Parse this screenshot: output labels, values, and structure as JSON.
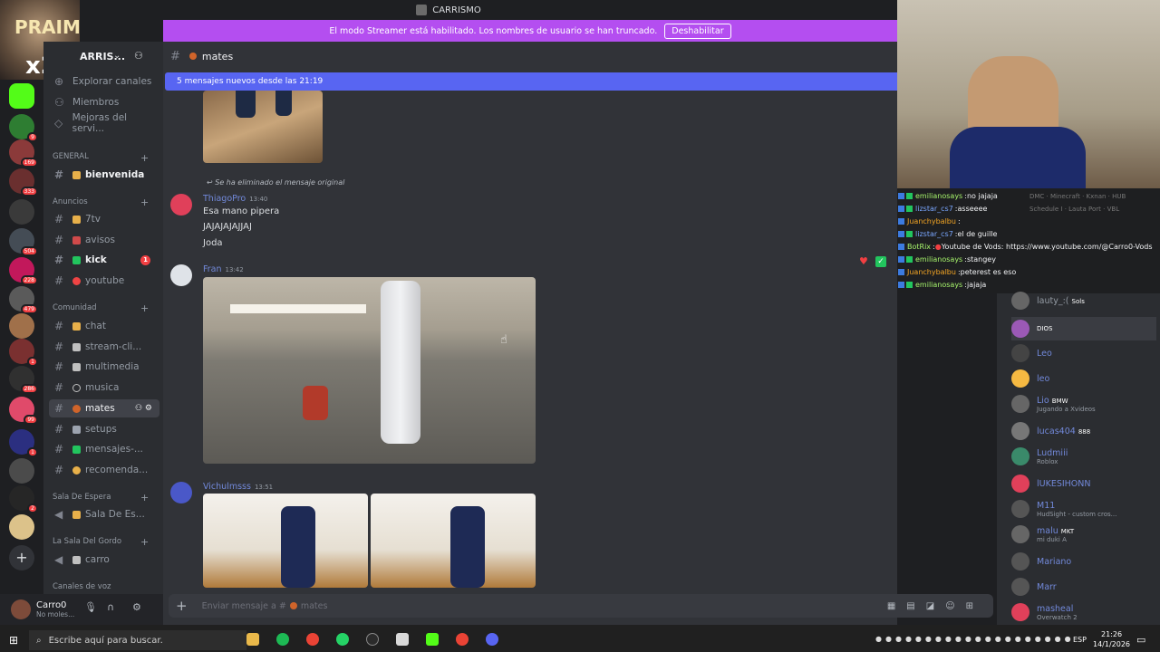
{
  "window": {
    "title": "CARRISMO"
  },
  "streamer_banner": {
    "text": "El modo Streamer está habilitado. Los nombres de usuario se han truncado.",
    "button": "Deshabilitar"
  },
  "overlay_corner": {
    "line1": "PRAIM",
    "line2": "x2"
  },
  "server": {
    "name": "ARRIS..."
  },
  "top_links": [
    "Explorar canales",
    "Miembros",
    "Mejoras del servi..."
  ],
  "categories": {
    "general": "GENERAL",
    "anuncios": "Anuncios",
    "comunidad": "Comunidad",
    "sala_espera": "Sala De Espera",
    "sala_gordo": "La Sala Del Gordo",
    "canales_voz": "Canales de voz"
  },
  "channels": {
    "bienvenida": "bienvenida",
    "tv": "7tv",
    "avisos": "avisos",
    "kick": "kick",
    "kick_badge": "1",
    "youtube": "youtube",
    "chat": "chat",
    "stream": "stream-cli...",
    "multimedia": "multimedia",
    "musica": "musica",
    "mates": "mates",
    "setups": "setups",
    "mensajes": "mensajes-...",
    "recomenda": "recomenda...",
    "salaespera": "Sala De Es...",
    "carro": "carro"
  },
  "server_badges": [
    "9",
    "169",
    "333",
    "504",
    "228",
    "479",
    "1",
    "286",
    "99",
    "1",
    "2"
  ],
  "user": {
    "name": "Carro0",
    "status": "No moles..."
  },
  "chat_header": {
    "channel": "mates"
  },
  "new_messages": "5 mensajes nuevos desde las 21:19",
  "messages": {
    "reply_note": "Se ha eliminado el mensaje original",
    "m1": {
      "author": "ThiagoPro",
      "time": "13:40",
      "lines": [
        "Esa mano pipera",
        "JAJAJAJAJJAJ",
        "Joda"
      ]
    },
    "m2": {
      "author": "Fran",
      "time": "13:42"
    },
    "m3": {
      "author": "Vichulmsss",
      "time": "13:51"
    }
  },
  "composer": {
    "placeholder": "Enviar mensaje a #",
    "channel": "mates"
  },
  "stream_chat": [
    {
      "user": "emilianosays",
      "text": "no jajaja"
    },
    {
      "user": "lizstar_cs7",
      "text": "asseeee"
    },
    {
      "user": "Juanchybalbu",
      "text": ""
    },
    {
      "user": "lizstar_cs7",
      "text": "el de guille"
    },
    {
      "user": "BotRix",
      "text": "Youtube de Vods: https://www.youtube.com/@Carro0-Vods"
    },
    {
      "user": "emilianosays",
      "text": "stangey"
    },
    {
      "user": "Juanchybalbu",
      "text": "peterest es eso"
    },
    {
      "user": "emilianosays",
      "text": "jajaja"
    }
  ],
  "members_behind": [
    "DMC",
    "Minecraft",
    "Kxnan",
    "HUB",
    "Schedule I",
    "Lauta Port",
    "VBL"
  ],
  "members": [
    {
      "name": "lauty_:(",
      "sub": "Sols"
    },
    {
      "name": "DIOS",
      "sub": ""
    },
    {
      "name": "Leo",
      "sub": ""
    },
    {
      "name": "leo",
      "sub": ""
    },
    {
      "name": "Lio",
      "sub": "Jugando a Xvideos",
      "tag": "BMW"
    },
    {
      "name": "lucas404",
      "sub": "",
      "tag": "888"
    },
    {
      "name": "Ludmiii",
      "sub": "Roblox"
    },
    {
      "name": "lUKESIHONN",
      "sub": ""
    },
    {
      "name": "M11",
      "sub": "HudSight - custom cros..."
    },
    {
      "name": "malu",
      "sub": "mi duki A",
      "tag": "MKT"
    },
    {
      "name": "Mariano",
      "sub": ""
    },
    {
      "name": "Marr",
      "sub": ""
    },
    {
      "name": "masheal",
      "sub": "Overwatch 2"
    }
  ],
  "taskbar": {
    "search": "Escribe aquí para buscar.",
    "lang": "ESP",
    "time": "21:26",
    "date": "14/1/2026"
  },
  "colors": {
    "accent": "#5865f2",
    "streamer": "#b44ef0",
    "badge": "#f23f42"
  }
}
